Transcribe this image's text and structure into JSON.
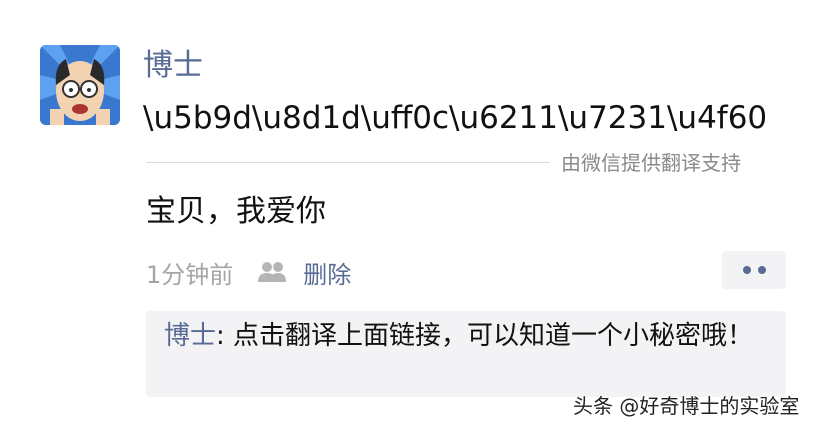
{
  "post": {
    "author": "博士",
    "text": "\\u5b9d\\u8d1d\\uff0c\\u6211\\u7231\\u4f60",
    "translate_credit": "由微信提供翻译支持",
    "translation": "宝贝，我爱你",
    "timestamp": "1分钟前",
    "delete_label": "删除",
    "visibility_icon": "group-icon",
    "more_icon": "ellipsis-icon"
  },
  "comment": {
    "commenter": "博士",
    "separator": ": ",
    "text": "点击翻译上面链接，可以知道一个小秘密哦！"
  },
  "watermark": "头条 @好奇博士的实验室",
  "colors": {
    "link": "#576b95",
    "muted": "#a5a5a5",
    "panel": "#f3f3f5"
  }
}
